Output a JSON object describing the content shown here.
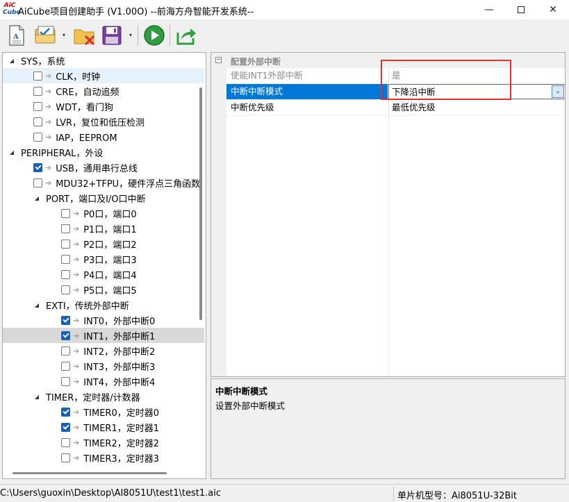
{
  "window": {
    "title": "AiCube项目创建助手 (V1.00O) --前海方舟智能开发系统--",
    "logo_line1": "AiC",
    "logo_line2": "Cube",
    "minimize": "—",
    "close": "✕"
  },
  "toolbar": {
    "buttons": [
      {
        "name": "new-document",
        "icon": "document-icon"
      },
      {
        "name": "settings-check",
        "icon": "checklist-icon"
      },
      {
        "name": "delete-folder",
        "icon": "folder-delete-icon"
      },
      {
        "name": "save",
        "icon": "floppy-icon"
      },
      {
        "name": "run",
        "icon": "play-icon"
      },
      {
        "name": "export",
        "icon": "export-icon"
      }
    ],
    "dropdown_glyph": "▾"
  },
  "tree": {
    "items": [
      {
        "label": "SYS，系统",
        "level": 0,
        "expander": "◢",
        "checkbox": false
      },
      {
        "label": "CLK，时钟",
        "level": 1,
        "checkbox": true,
        "checked": false,
        "hover": true
      },
      {
        "label": "CRE，自动追频",
        "level": 1,
        "checkbox": true,
        "checked": false
      },
      {
        "label": "WDT，看门狗",
        "level": 1,
        "checkbox": true,
        "checked": false
      },
      {
        "label": "LVR，复位和低压检测",
        "level": 1,
        "checkbox": true,
        "checked": false
      },
      {
        "label": "IAP，EEPROM",
        "level": 1,
        "checkbox": true,
        "checked": false
      },
      {
        "label": "PERIPHERAL，外设",
        "level": 0,
        "expander": "◢",
        "checkbox": false
      },
      {
        "label": "USB，通用串行总线",
        "level": 1,
        "checkbox": true,
        "checked": true
      },
      {
        "label": "MDU32+TFPU，硬件浮点三角函数",
        "level": 1,
        "checkbox": true,
        "checked": false
      },
      {
        "label": "PORT，端口及I/O口中断",
        "level": 1,
        "expander": "◢",
        "checkbox": false
      },
      {
        "label": "P0口，端口0",
        "level": 2,
        "checkbox": true,
        "checked": false
      },
      {
        "label": "P1口，端口1",
        "level": 2,
        "checkbox": true,
        "checked": false
      },
      {
        "label": "P2口，端口2",
        "level": 2,
        "checkbox": true,
        "checked": false
      },
      {
        "label": "P3口，端口3",
        "level": 2,
        "checkbox": true,
        "checked": false
      },
      {
        "label": "P4口，端口4",
        "level": 2,
        "checkbox": true,
        "checked": false
      },
      {
        "label": "P5口，端口5",
        "level": 2,
        "checkbox": true,
        "checked": false
      },
      {
        "label": "EXTI，传统外部中断",
        "level": 1,
        "expander": "◢",
        "checkbox": false
      },
      {
        "label": "INT0，外部中断0",
        "level": 2,
        "checkbox": true,
        "checked": true
      },
      {
        "label": "INT1，外部中断1",
        "level": 2,
        "checkbox": true,
        "checked": true,
        "selected": true
      },
      {
        "label": "INT2，外部中断2",
        "level": 2,
        "checkbox": true,
        "checked": false
      },
      {
        "label": "INT3，外部中断3",
        "level": 2,
        "checkbox": true,
        "checked": false
      },
      {
        "label": "INT4，外部中断4",
        "level": 2,
        "checkbox": true,
        "checked": false
      },
      {
        "label": "TIMER，定时器/计数器",
        "level": 1,
        "expander": "◢",
        "checkbox": false
      },
      {
        "label": "TIMER0，定时器0",
        "level": 2,
        "checkbox": true,
        "checked": true
      },
      {
        "label": "TIMER1，定时器1",
        "level": 2,
        "checkbox": true,
        "checked": true
      },
      {
        "label": "TIMER2，定时器2",
        "level": 2,
        "checkbox": true,
        "checked": false
      },
      {
        "label": "TIMER3，定时器3",
        "level": 2,
        "checkbox": true,
        "checked": false
      }
    ],
    "arrow_glyph": "➔"
  },
  "properties": {
    "category": "配置外部中断",
    "category_toggle": "−",
    "rows": [
      {
        "name": "使能INT1外部中断",
        "value": "是",
        "dim": true
      },
      {
        "name": "中断中断模式",
        "value": "下降沿中断",
        "selected": true
      },
      {
        "name": "中断优先级",
        "value": "最低优先级"
      }
    ],
    "dropdown_glyph": "⌄"
  },
  "description": {
    "title": "中断中断模式",
    "text": "设置外部中断模式"
  },
  "status": {
    "path": "C:\\Users\\guoxin\\Desktop\\AI8051U\\test1\\test1.aic",
    "chip": "单片机型号：Ai8051U-32Bit"
  },
  "colors": {
    "selection": "#0078d7",
    "highlight_box": "#e23030",
    "check": "#1a5fb4"
  }
}
